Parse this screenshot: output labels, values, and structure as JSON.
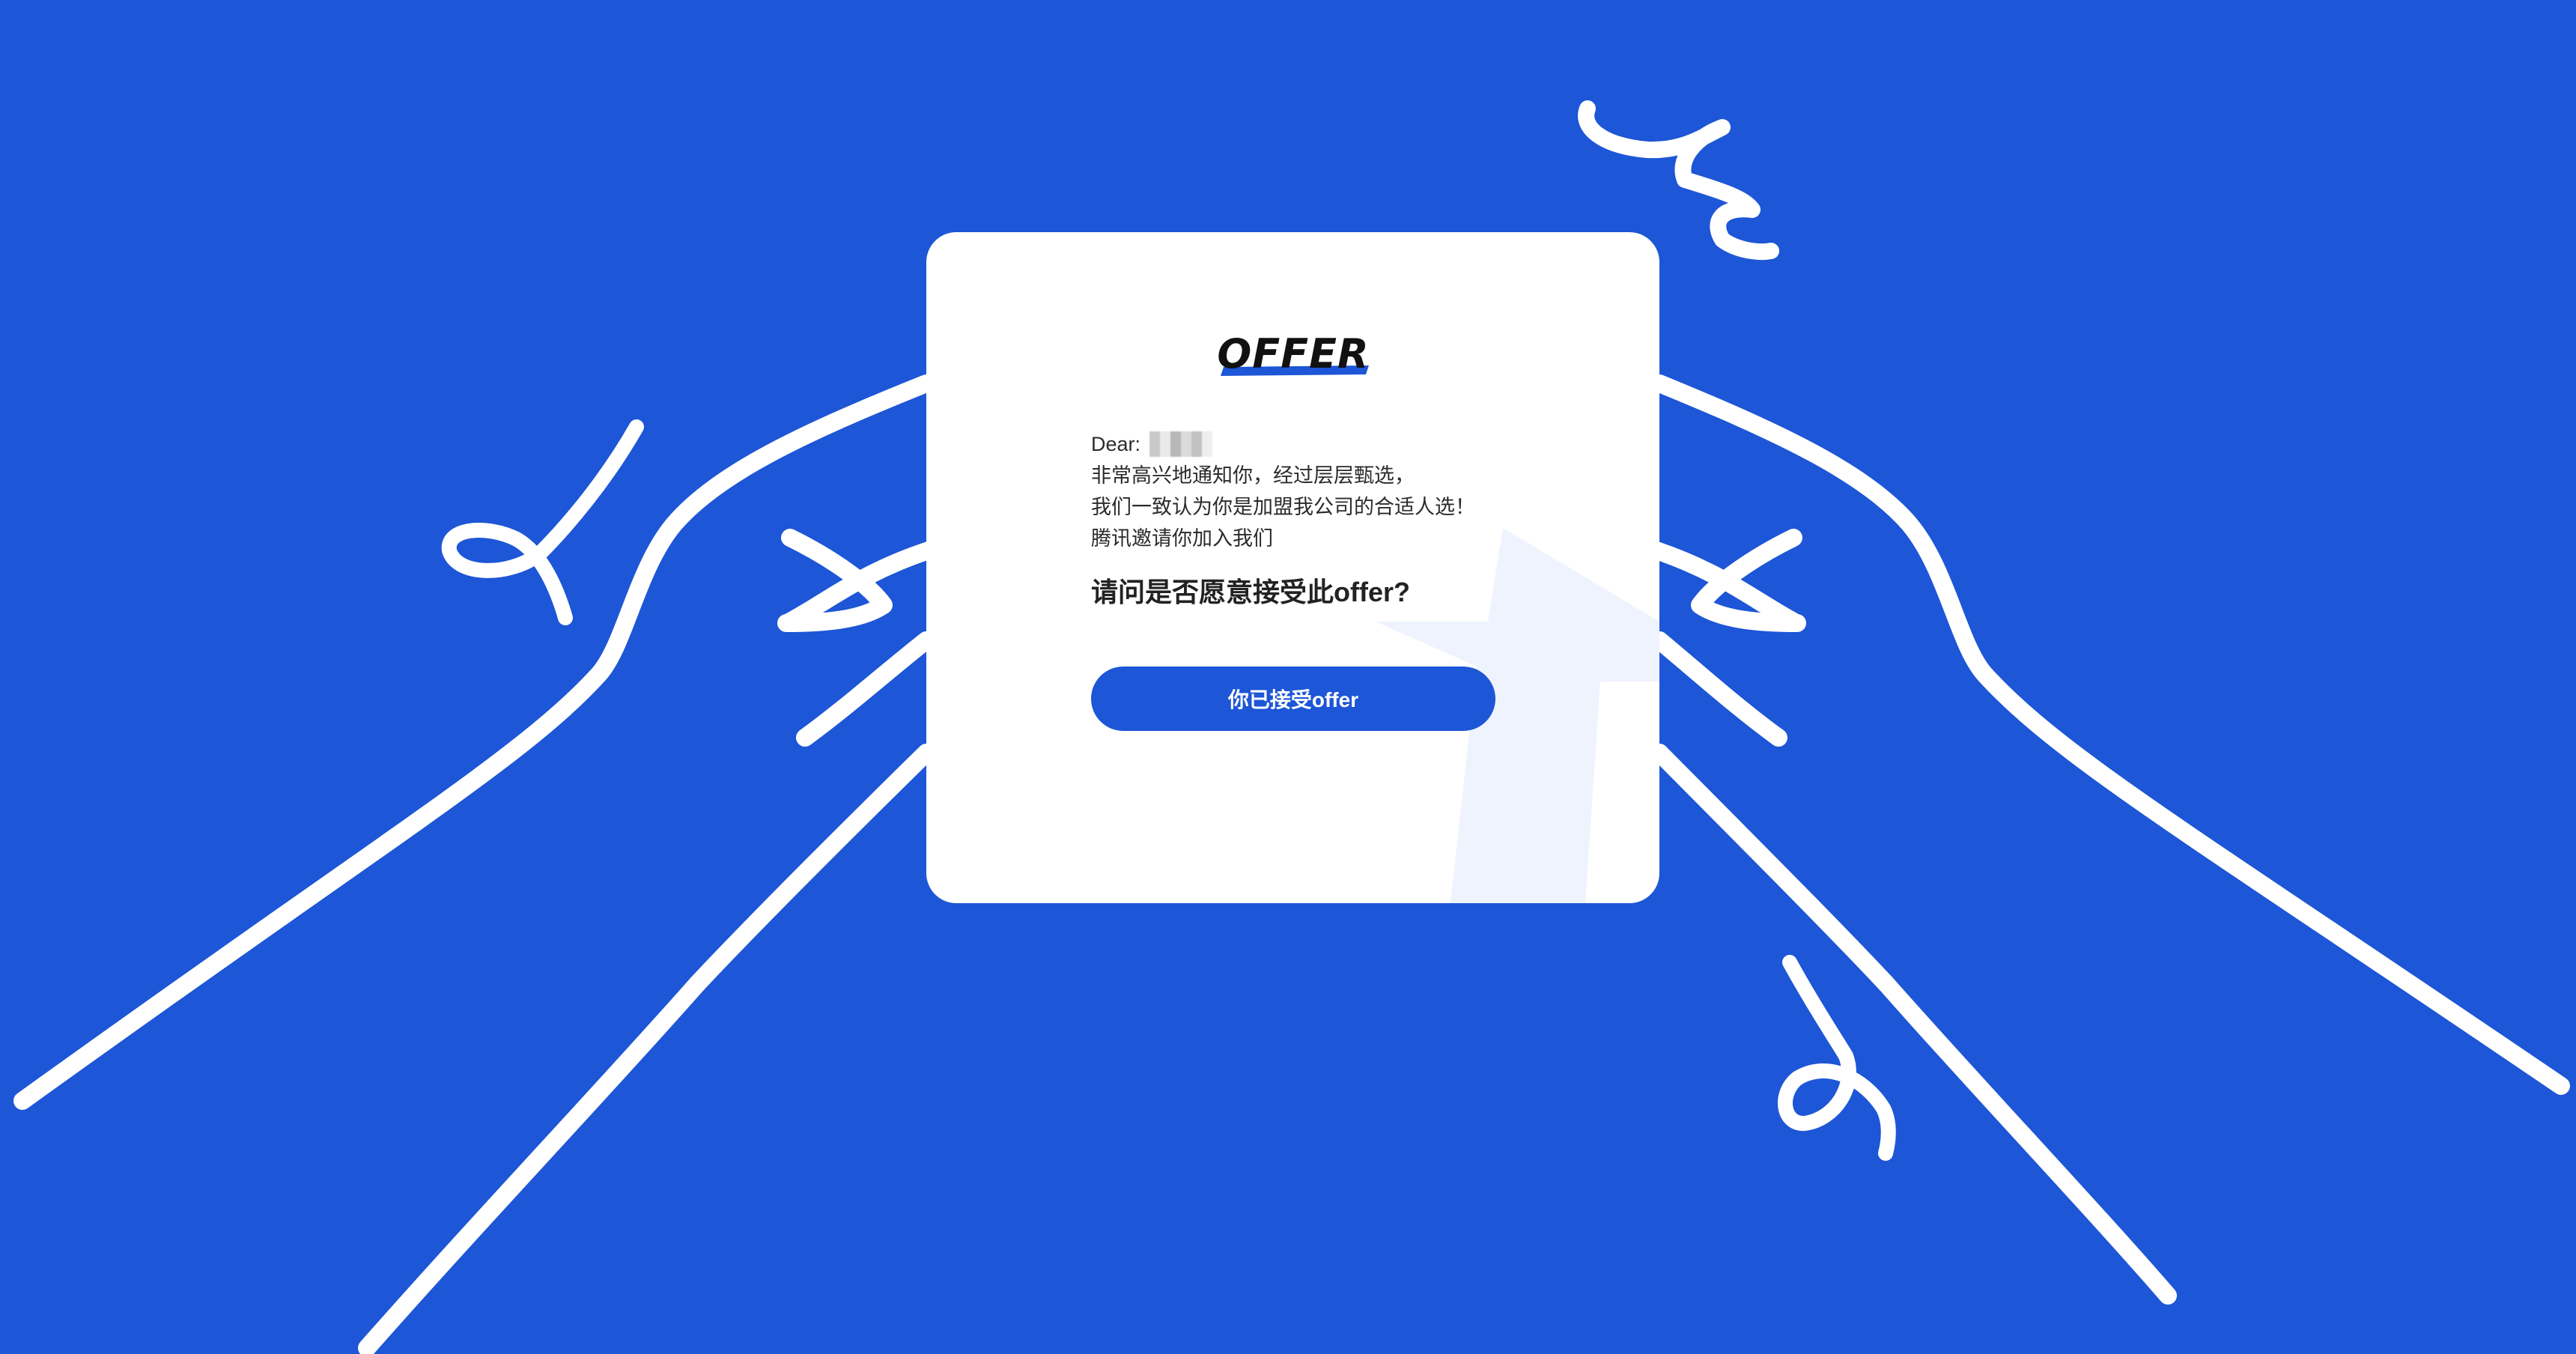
{
  "colors": {
    "background": "#1D56D6",
    "card": "#FFFFFF",
    "accent": "#1D56D6",
    "line_art": "#FFFFFF",
    "watermark": "#EEF3FD"
  },
  "card": {
    "logo_text": "OFFER",
    "letter": {
      "greeting": "Dear:",
      "recipient": "",
      "lines": [
        "非常高兴地通知你，经过层层甄选，",
        "我们一致认为你是加盟我公司的合适人选！",
        "腾讯邀请你加入我们"
      ]
    },
    "question": "请问是否愿意接受此offer?",
    "accept_button_label": "你已接受offer"
  },
  "icons": {
    "hands": "hands-holding-card-illustration",
    "squiggles": "squiggle-decoration"
  }
}
